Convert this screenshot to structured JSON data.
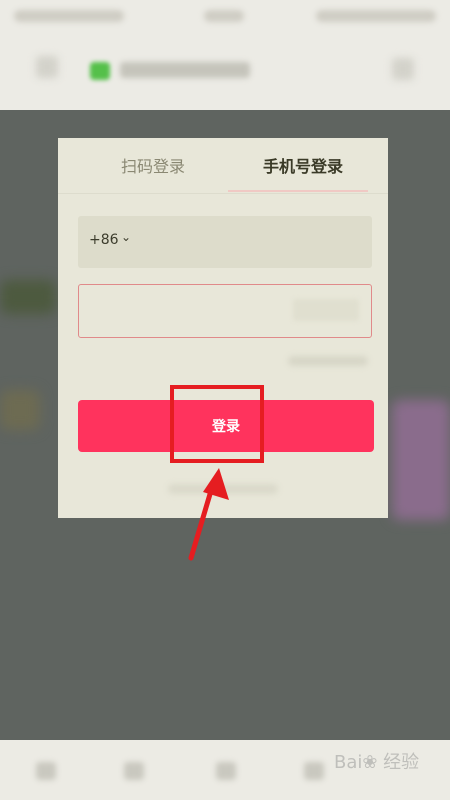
{
  "modal": {
    "tabs": {
      "qr_login": "扫码登录",
      "phone_login": "手机号登录"
    },
    "phone": {
      "country_code": "+86",
      "placeholder": ""
    },
    "code": {
      "placeholder": ""
    },
    "login_button": "登录"
  },
  "watermark": "Bai❀ 经验",
  "colors": {
    "accent": "#ff335d",
    "highlight": "#e51d21",
    "overlay": "#5f6460",
    "modal": "#e8e7d9"
  }
}
